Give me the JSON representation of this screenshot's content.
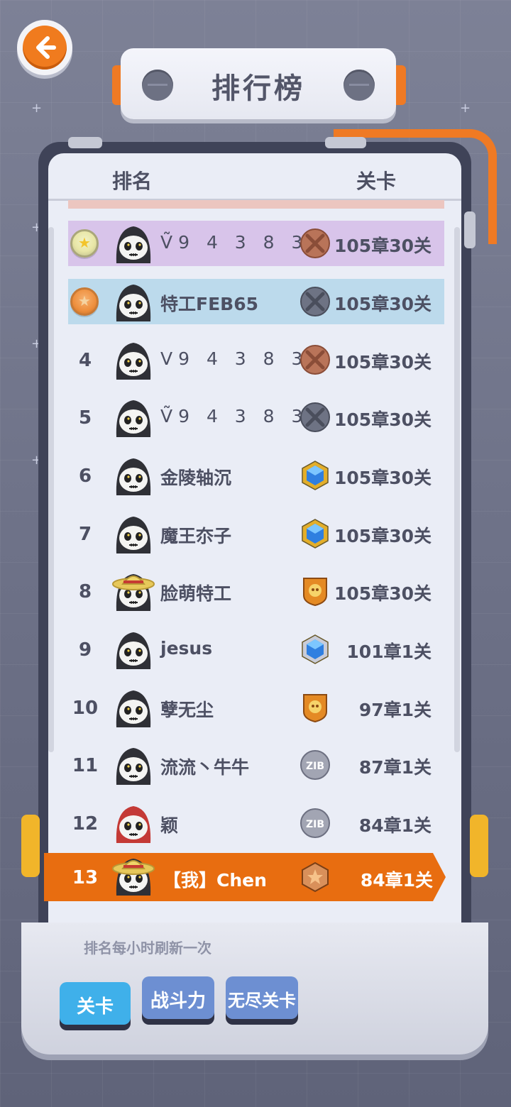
{
  "header": {
    "back_icon": "left-arrow-icon",
    "title": "排行榜"
  },
  "columns": {
    "rank": "排名",
    "level": "关卡"
  },
  "rows": [
    {
      "rank": "",
      "medal": "gold",
      "name": "Ṽ9 4 3 8 3",
      "avatar": "skull-hood",
      "badge": "bronze-crossed-shield",
      "level": "105章30关"
    },
    {
      "rank": "",
      "medal": "bronze",
      "name": "特工FEB65",
      "avatar": "skull-hood",
      "badge": "steel-crossed-shield",
      "level": "105章30关"
    },
    {
      "rank": "4",
      "name": "V9 4 3 8 3",
      "avatar": "skull-hood",
      "badge": "bronze-crossed-shield",
      "level": "105章30关"
    },
    {
      "rank": "5",
      "name": "Ṽ9 4 3 8 3",
      "avatar": "skull-hood",
      "badge": "steel-crossed-shield",
      "level": "105章30关"
    },
    {
      "rank": "6",
      "name": "金陵轴沉",
      "avatar": "skull-hood",
      "badge": "gold-blue-gem",
      "level": "105章30关"
    },
    {
      "rank": "7",
      "name": "魔王夵子",
      "avatar": "skull-hood",
      "badge": "gold-blue-gem",
      "level": "105章30关"
    },
    {
      "rank": "8",
      "name": "脸萌特工",
      "avatar": "skull-straw-hat",
      "badge": "orange-skull-shield",
      "level": "105章30关"
    },
    {
      "rank": "9",
      "name": "jesus",
      "avatar": "skull-hood",
      "badge": "silver-blue-gem",
      "level": "101章1关"
    },
    {
      "rank": "10",
      "name": "孽无尘",
      "avatar": "skull-hood",
      "badge": "orange-skull-shield",
      "level": "97章1关"
    },
    {
      "rank": "11",
      "name": "流流丶牛牛",
      "avatar": "skull-hood",
      "badge": "silver-zib-coin",
      "level": "87章1关"
    },
    {
      "rank": "12",
      "name": "颖",
      "avatar": "red-hair",
      "badge": "silver-zib-coin",
      "level": "84章1关"
    }
  ],
  "me": {
    "rank": "13",
    "name": "【我】Chen",
    "avatar": "skull-straw-hat",
    "badge": "bronze-star-shield",
    "level": "84章1关"
  },
  "footnote": "排名每小时刷新一次",
  "tabs": [
    {
      "label": "关卡",
      "active": true
    },
    {
      "label": "战斗力",
      "active": false
    },
    {
      "label": "无尽关卡",
      "active": false
    }
  ],
  "colors": {
    "accent_orange": "#e86d10",
    "panel": "#eaedf6",
    "board": "#3f4358",
    "tab_active": "#3fb0ea",
    "tab_inactive": "#6d8fd2"
  }
}
